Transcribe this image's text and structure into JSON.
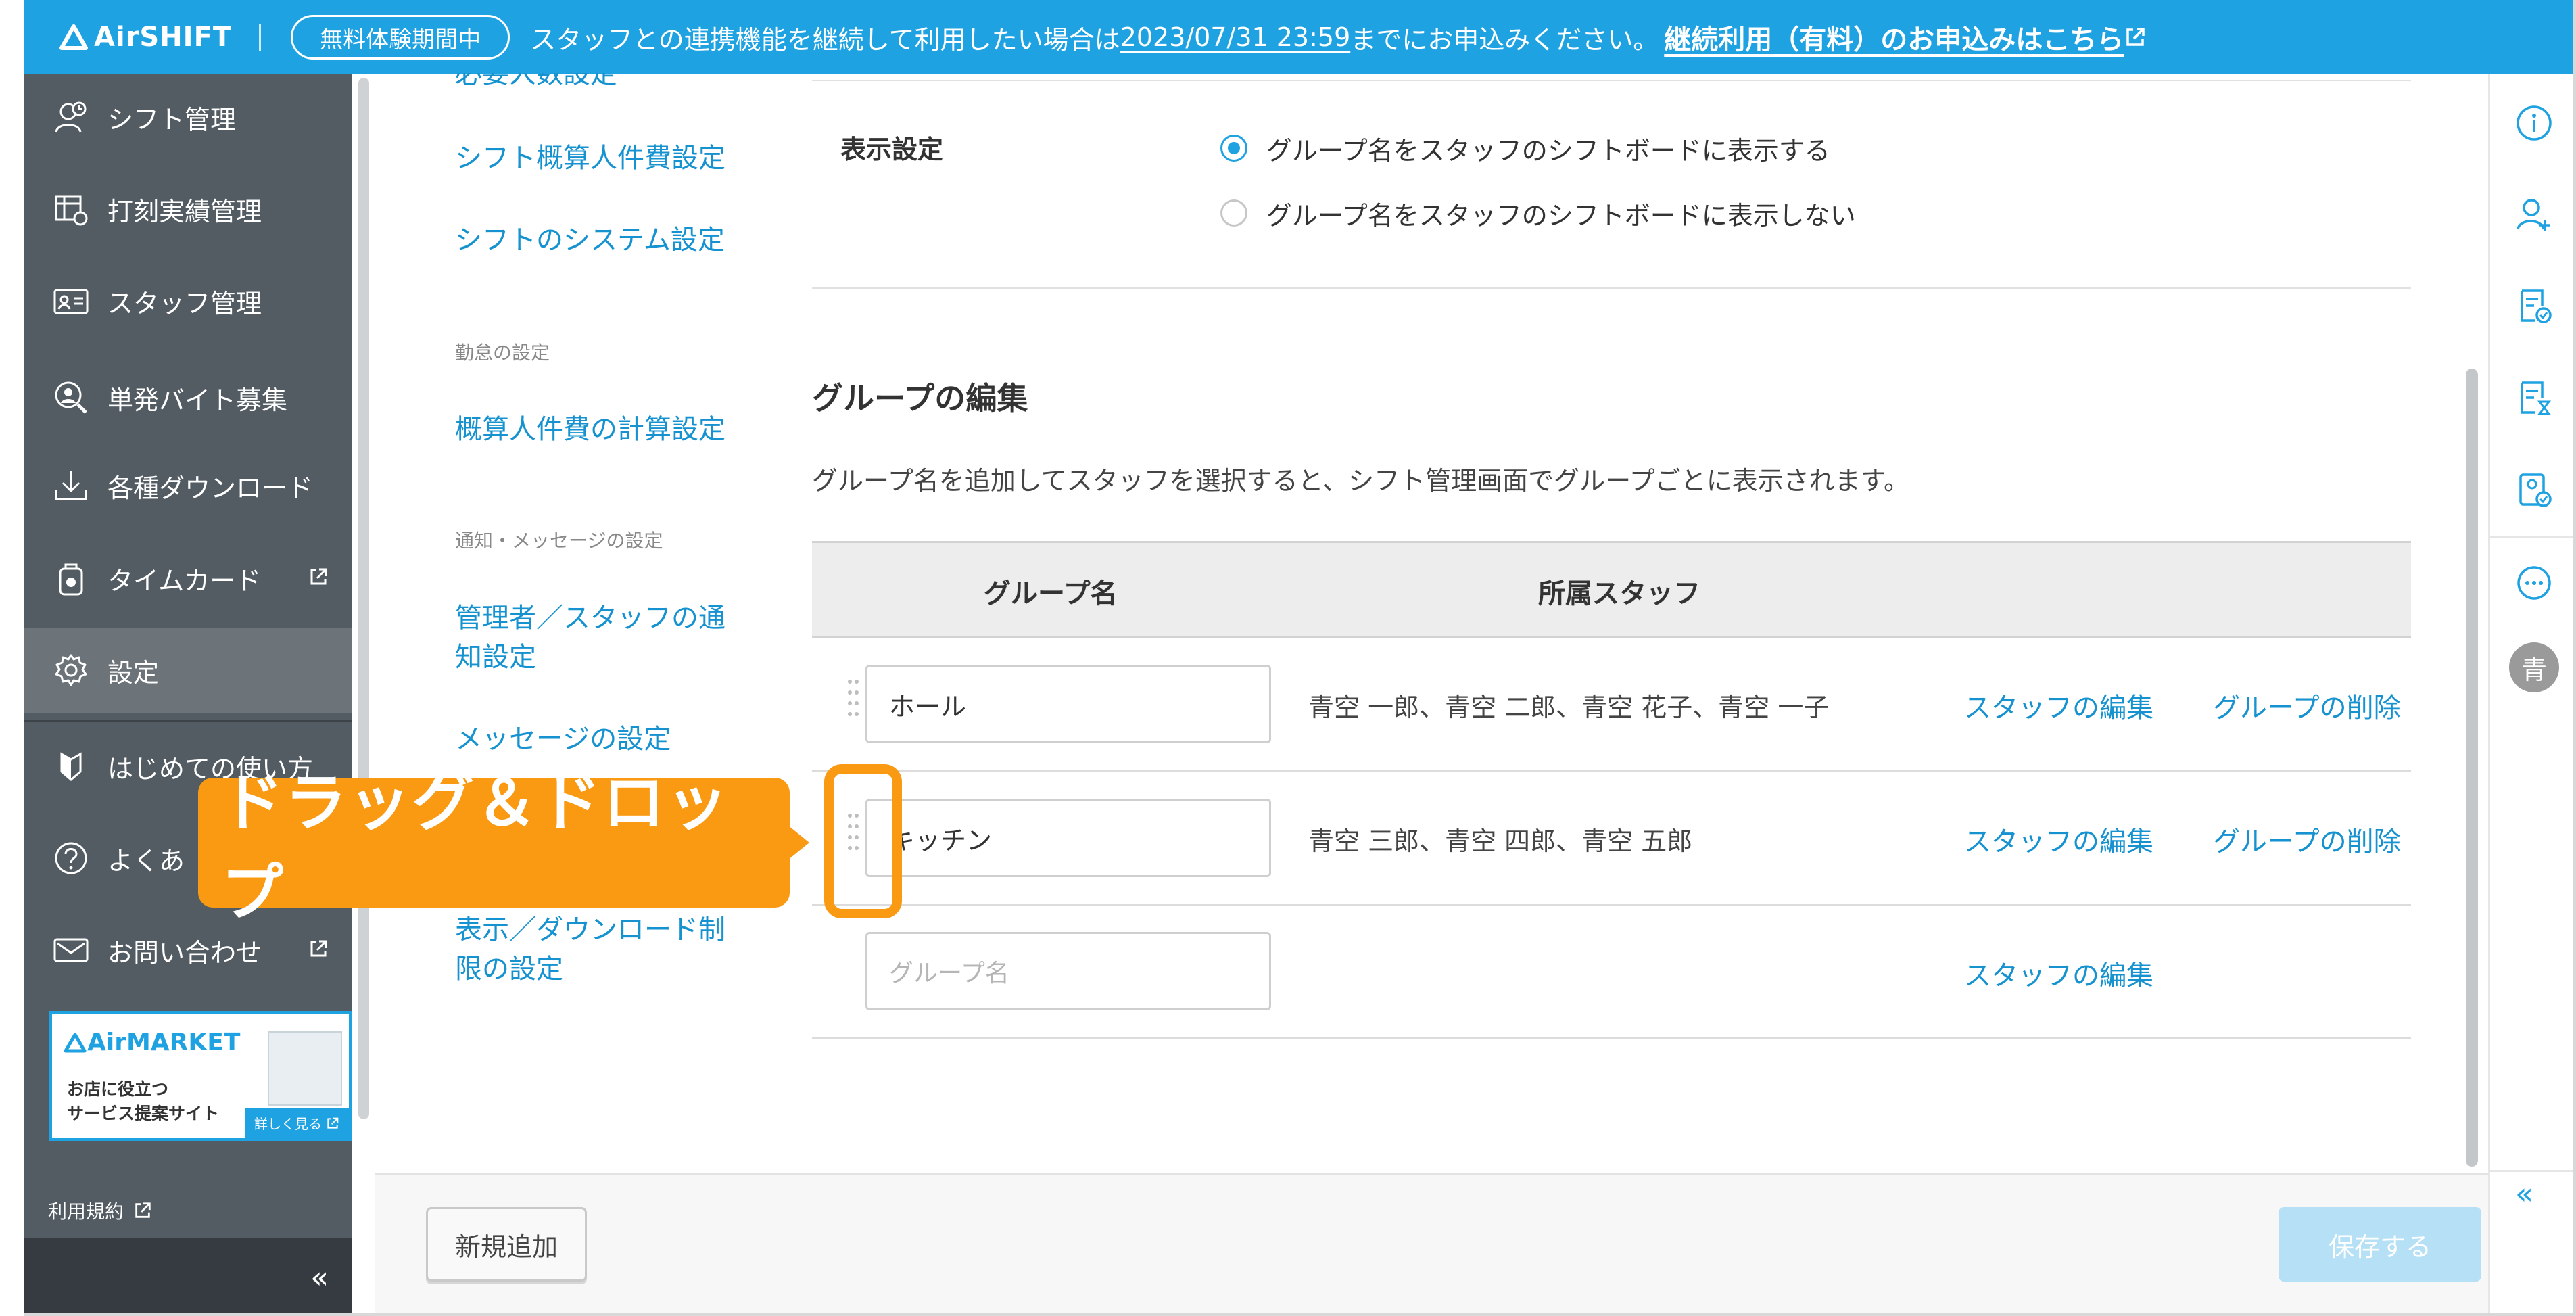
{
  "brand": {
    "name": "AirSHIFT",
    "accent": "#1fa2e1",
    "callout_color": "#fa9a12"
  },
  "banner": {
    "badge": "無料体験期間中",
    "notice_before": "スタッフとの連携機能を継続して利用したい場合は",
    "notice_date": "2023/07/31 23:59",
    "notice_after": "までにお申込みください。",
    "link": "継続利用（有料）のお申込みはこちら"
  },
  "sidebar": {
    "items": [
      {
        "label": "シフト管理",
        "icon": "clock-person-icon"
      },
      {
        "label": "打刻実績管理",
        "icon": "timesheet-icon"
      },
      {
        "label": "スタッフ管理",
        "icon": "id-card-icon"
      },
      {
        "label": "単発バイト募集",
        "icon": "search-person-icon"
      },
      {
        "label": "各種ダウンロード",
        "icon": "download-icon"
      },
      {
        "label": "タイムカード",
        "icon": "timecard-icon"
      },
      {
        "label": "設定",
        "icon": "gear-icon"
      },
      {
        "label": "はじめての使い方",
        "icon": "leaf-icon"
      },
      {
        "label": "よくあ",
        "icon": "question-icon"
      },
      {
        "label": "お問い合わせ",
        "icon": "mail-icon"
      }
    ],
    "market": {
      "title": "AirMARKET",
      "line1": "お店に役立つ",
      "line2": "サービス提案サイト",
      "more": "詳しく見る"
    },
    "terms": "利用規約"
  },
  "subnav": {
    "partial_top": "必要人数設定",
    "link1": "シフト概算人件費設定",
    "link2": "シフトのシステム設定",
    "head1": "勤怠の設定",
    "link3": "概算人件費の計算設定",
    "head2": "通知・メッセージの設定",
    "link4a": "管理者／スタッフの通",
    "link4b": "知設定",
    "link5": "メッセージの設定",
    "link6a": "表示／ダウンロード制",
    "link6b": "限の設定"
  },
  "display_setting": {
    "label": "表示設定",
    "options": [
      {
        "label": "グループ名をスタッフのシフトボードに表示する",
        "selected": true
      },
      {
        "label": "グループ名をスタッフのシフトボードに表示しない",
        "selected": false
      }
    ]
  },
  "group_edit": {
    "title": "グループの編集",
    "description": "グループ名を追加してスタッフを選択すると、シフト管理画面でグループごとに表示されます。",
    "columns": {
      "name": "グループ名",
      "staff": "所属スタッフ"
    },
    "rows": [
      {
        "name": "ホール",
        "staff": "青空 一郎、青空 二郎、青空 花子、青空 一子",
        "edit": "スタッフの編集",
        "delete": "グループの削除"
      },
      {
        "name": "キッチン",
        "staff": "青空 三郎、青空 四郎、青空 五郎",
        "edit": "スタッフの編集",
        "delete": "グループの削除"
      }
    ],
    "new_row": {
      "placeholder": "グループ名",
      "edit": "スタッフの編集"
    }
  },
  "footer": {
    "add": "新規追加",
    "save": "保存する"
  },
  "rail": {
    "avatar": "青"
  },
  "annotation": {
    "callout": "ドラッグ＆ドロップ"
  }
}
